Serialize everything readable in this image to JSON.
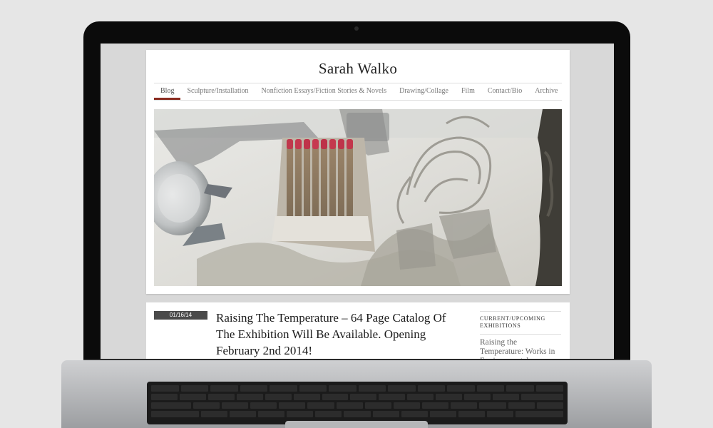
{
  "site": {
    "title": "Sarah Walko",
    "accent_color": "#8a2b1f"
  },
  "nav": {
    "items": [
      {
        "label": "Blog",
        "active": true
      },
      {
        "label": "Sculpture/Installation",
        "active": false
      },
      {
        "label": "Nonfiction Essays/Fiction Stories & Novels",
        "active": false
      },
      {
        "label": "Drawing/Collage",
        "active": false
      },
      {
        "label": "Film",
        "active": false
      },
      {
        "label": "Contact/Bio",
        "active": false
      },
      {
        "label": "Archive",
        "active": false
      }
    ]
  },
  "hero": {
    "icon": "hero-photo-matchbook-sculpture"
  },
  "post": {
    "date": "01/16/14",
    "title": "Raising The Temperature – 64 Page Catalog Of The Exhibition Will Be Available. Opening February 2nd 2014!"
  },
  "sidebar": {
    "heading": "Current/Upcoming Exhibitions",
    "link": "Raising the Temperature: Works in Environmental"
  }
}
